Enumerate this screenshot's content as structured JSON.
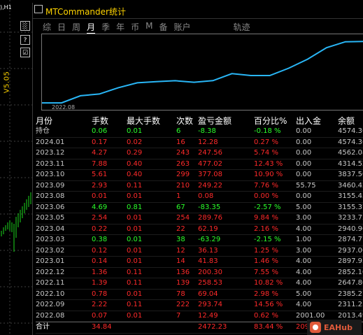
{
  "chart_window": {
    "symbol_label": "),H1",
    "version_label": "V5.05"
  },
  "side_buttons": [
    "░",
    "?",
    "☑"
  ],
  "title": "MTCommander统计",
  "tabs": [
    {
      "label": "综"
    },
    {
      "label": "日"
    },
    {
      "label": "周"
    },
    {
      "label": "月",
      "active": true
    },
    {
      "label": "季"
    },
    {
      "label": "年"
    },
    {
      "label": "币"
    },
    {
      "label": "M"
    },
    {
      "label": "备"
    },
    {
      "label": "账户"
    },
    {
      "label": "轨迹"
    }
  ],
  "mini_chart_date": "2022.08",
  "table": {
    "headers": [
      "月份",
      "手数",
      "最大手数",
      "次数",
      "盈亏金额",
      "百分比%",
      "出入金",
      "余额"
    ],
    "rows": [
      {
        "cells": [
          "持仓",
          "0.06",
          "0.01",
          "6",
          "-8.38",
          "-0.18 %",
          "0.00",
          "4574.36"
        ],
        "style": "green"
      },
      {
        "cells": [
          "2024.01",
          "0.17",
          "0.02",
          "16",
          "12.28",
          "0.27 %",
          "0.00",
          "4574.36"
        ],
        "style": "red"
      },
      {
        "cells": [
          "2023.12",
          "4.27",
          "0.29",
          "243",
          "247.56",
          "5.74 %",
          "0.00",
          "4562.08"
        ],
        "style": "red"
      },
      {
        "cells": [
          "2023.11",
          "7.88",
          "0.40",
          "263",
          "477.02",
          "12.43 %",
          "0.00",
          "4314.52"
        ],
        "style": "red"
      },
      {
        "cells": [
          "2023.10",
          "5.61",
          "0.40",
          "299",
          "377.08",
          "10.90 %",
          "0.00",
          "3837.50"
        ],
        "style": "red"
      },
      {
        "cells": [
          "2023.09",
          "2.93",
          "0.11",
          "210",
          "249.22",
          "7.76 %",
          "55.75",
          "3460.42"
        ],
        "style": "red"
      },
      {
        "cells": [
          "2023.08",
          "0.01",
          "0.01",
          "1",
          "0.08",
          "0.00 %",
          "0.00",
          "3155.45"
        ],
        "style": "red"
      },
      {
        "cells": [
          "2023.06",
          "4.69",
          "0.81",
          "67",
          "-83.35",
          "-2.57 %",
          "5.00",
          "3155.37"
        ],
        "style": "green"
      },
      {
        "cells": [
          "2023.05",
          "2.54",
          "0.01",
          "254",
          "289.76",
          "9.84 %",
          "3.00",
          "3233.72"
        ],
        "style": "red"
      },
      {
        "cells": [
          "2023.04",
          "0.22",
          "0.01",
          "22",
          "62.19",
          "2.16 %",
          "4.00",
          "2940.96"
        ],
        "style": "red"
      },
      {
        "cells": [
          "2023.03",
          "0.38",
          "0.01",
          "38",
          "-63.29",
          "-2.15 %",
          "1.00",
          "2874.77"
        ],
        "style": "green"
      },
      {
        "cells": [
          "2023.02",
          "0.12",
          "0.01",
          "12",
          "36.13",
          "1.25 %",
          "3.00",
          "2937.06"
        ],
        "style": "red"
      },
      {
        "cells": [
          "2023.01",
          "0.14",
          "0.01",
          "14",
          "41.83",
          "1.46 %",
          "4.00",
          "2897.93"
        ],
        "style": "red"
      },
      {
        "cells": [
          "2022.12",
          "1.36",
          "0.11",
          "136",
          "200.30",
          "7.55 %",
          "4.00",
          "2852.10"
        ],
        "style": "red"
      },
      {
        "cells": [
          "2022.11",
          "1.39",
          "0.11",
          "139",
          "258.53",
          "10.82 %",
          "4.00",
          "2647.80"
        ],
        "style": "red"
      },
      {
        "cells": [
          "2022.10",
          "0.78",
          "0.01",
          "78",
          "69.04",
          "2.98 %",
          "5.00",
          "2385.27"
        ],
        "style": "red"
      },
      {
        "cells": [
          "2022.09",
          "2.22",
          "0.11",
          "222",
          "293.74",
          "14.56 %",
          "4.00",
          "2311.23"
        ],
        "style": "red"
      },
      {
        "cells": [
          "2022.08",
          "0.07",
          "0.01",
          "7",
          "12.49",
          "0.62 %",
          "2001.00",
          "2013.49"
        ],
        "style": "red"
      }
    ],
    "total": {
      "cells": [
        "合计",
        "34.84",
        "",
        "",
        "2472.23",
        "83.44 %",
        "2093.75",
        ""
      ]
    }
  },
  "watermark": "EAHub",
  "colors": {
    "title": "#ffd400",
    "loss": "#2bff2b",
    "profit": "#ff2a2a",
    "curve": "#29b6f6"
  },
  "balance_curve": [
    2013.49,
    2311.23,
    2385.27,
    2647.8,
    2852.1,
    2897.93,
    2937.06,
    2874.77,
    2940.96,
    3233.72,
    3155.37,
    3155.45,
    3460.42,
    3837.5,
    4314.52,
    4562.08,
    4574.36
  ]
}
